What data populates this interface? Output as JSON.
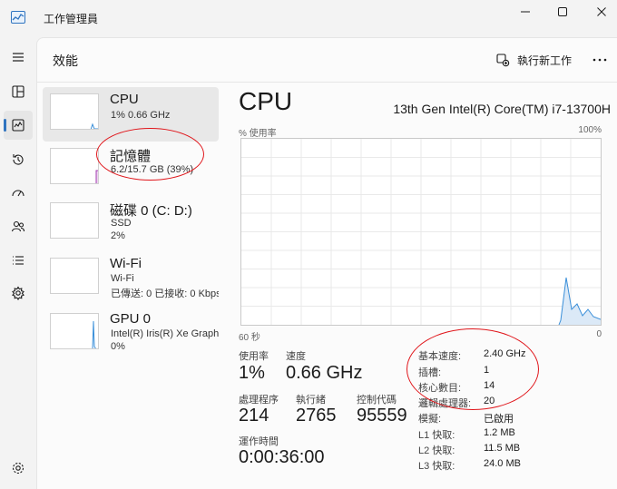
{
  "window": {
    "title": "工作管理員",
    "accent": "#2f74c0",
    "annotation_color": "#e0161b"
  },
  "nav_icons": [
    "hamburger-icon",
    "processes-icon",
    "performance-icon",
    "history-icon",
    "startup-icon",
    "users-icon",
    "details-icon",
    "services-icon",
    "settings-icon"
  ],
  "header": {
    "title": "效能",
    "run_task_label": "執行新工作"
  },
  "perf_items": [
    {
      "name": "CPU",
      "sub1": "1% 0.66 GHz",
      "sub2": ""
    },
    {
      "name": "記憶體",
      "sub1": "6.2/15.7 GB (39%)",
      "sub2": ""
    },
    {
      "name": "磁碟 0 (C: D:)",
      "sub1": "SSD",
      "sub2": "2%"
    },
    {
      "name": "Wi-Fi",
      "sub1": "Wi-Fi",
      "sub2": "已傳送: 0 已接收: 0 Kbps"
    },
    {
      "name": "GPU 0",
      "sub1": "Intel(R) Iris(R) Xe Graphics",
      "sub2": "0%"
    }
  ],
  "detail": {
    "title": "CPU",
    "model": "13th Gen Intel(R) Core(TM) i7-13700H",
    "y_label": "% 使用率",
    "y_max_label": "100%",
    "x_left_label": "60 秒",
    "x_right_label": "0",
    "stats": {
      "usage_label": "使用率",
      "usage_value": "1%",
      "speed_label": "速度",
      "speed_value": "0.66 GHz",
      "proc_label": "處理程序",
      "proc_value": "214",
      "thread_label": "執行緒",
      "thread_value": "2765",
      "handle_label": "控制代碼",
      "handle_value": "95559",
      "uptime_label": "運作時間",
      "uptime_value": "0:00:36:00"
    },
    "specs": [
      {
        "k": "基本速度:",
        "v": "2.40 GHz"
      },
      {
        "k": "插槽:",
        "v": "1"
      },
      {
        "k": "核心數目:",
        "v": "14"
      },
      {
        "k": "邏輯處理器:",
        "v": "20"
      },
      {
        "k": "模擬:",
        "v": "已啟用"
      },
      {
        "k": "L1 快取:",
        "v": "1.2 MB"
      },
      {
        "k": "L2 快取:",
        "v": "11.5 MB"
      },
      {
        "k": "L3 快取:",
        "v": "24.0 MB"
      }
    ]
  }
}
